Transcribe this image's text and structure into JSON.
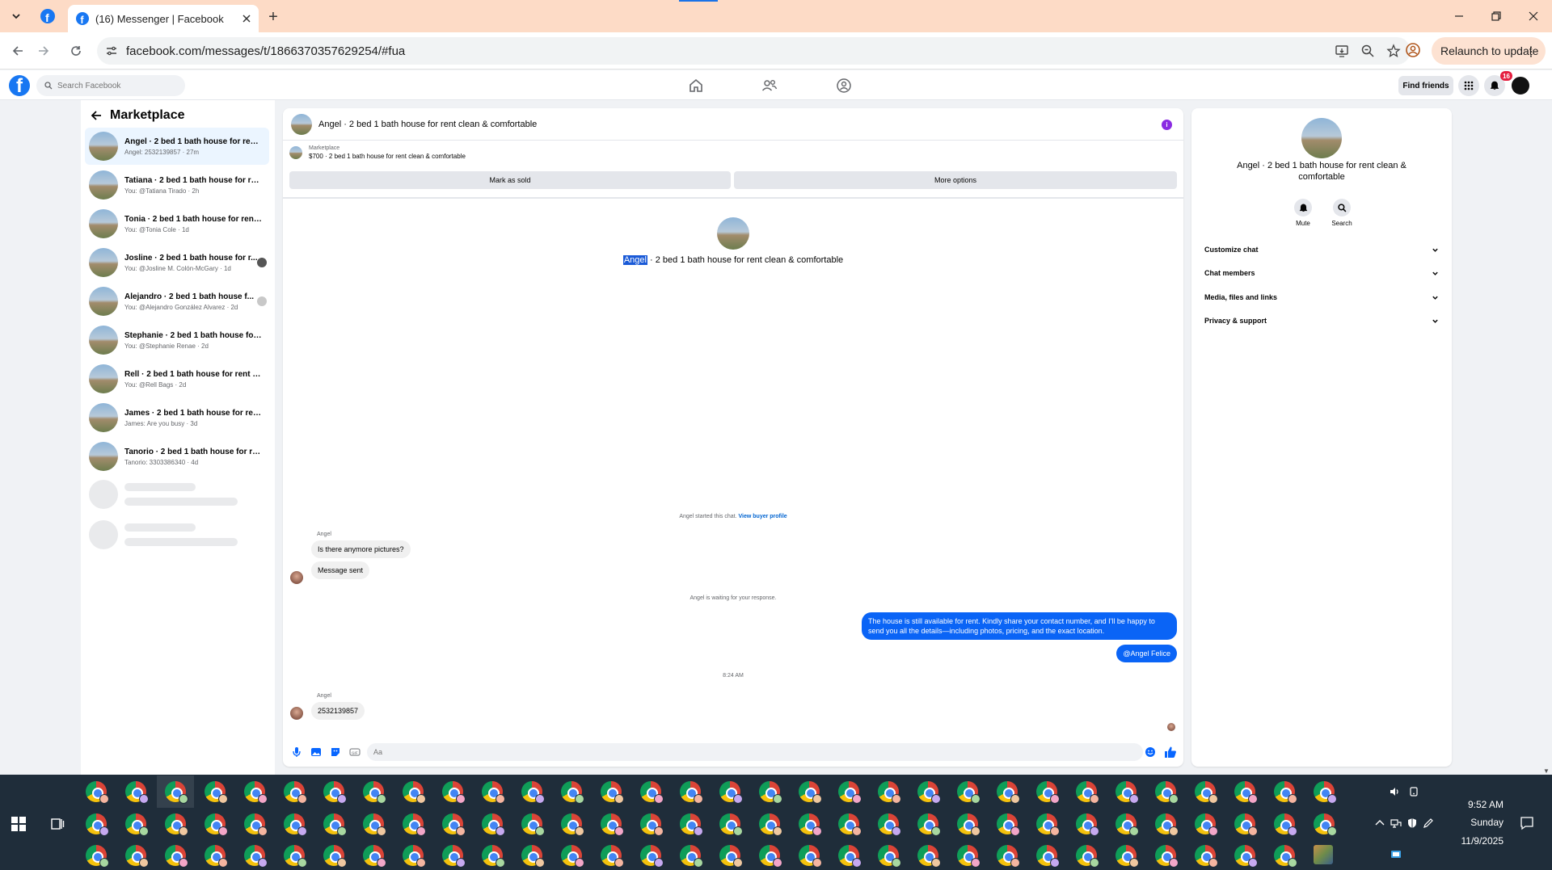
{
  "browser": {
    "tab_title": "(16) Messenger | Facebook",
    "url": "facebook.com/messages/t/1866370357629254/#fua",
    "relaunch_label": "Relaunch to update"
  },
  "fb": {
    "search_placeholder": "Search Facebook",
    "find_friends_label": "Find friends",
    "notification_count": "16",
    "brand_color": "#1877f2"
  },
  "sidebar": {
    "title": "Marketplace",
    "conversations": [
      {
        "name": "Angel · 2 bed 1 bath house for rent...",
        "sub": "Angel: 2532139857 · 27m"
      },
      {
        "name": "Tatiana · 2 bed 1 bath house for re...",
        "sub": "You: @Tatiana Tirado · 2h"
      },
      {
        "name": "Tonia · 2 bed 1 bath house for rent...",
        "sub": "You: @Tonia Cole · 1d"
      },
      {
        "name": "Josline · 2 bed 1 bath house for r...",
        "sub": "You: @Josline M. Colón-McGary · 1d"
      },
      {
        "name": "Alejandro · 2 bed 1 bath house f...",
        "sub": "You: @Alejandro González Alvarez · 2d"
      },
      {
        "name": "Stephanie · 2 bed 1 bath house for ...",
        "sub": "You: @Stephanie Renae · 2d"
      },
      {
        "name": "Rell · 2 bed 1 bath house for rent cl...",
        "sub": "You: @Rell Bags · 2d"
      },
      {
        "name": "James · 2 bed 1 bath house for ren...",
        "sub": "James: Are you busy · 3d"
      },
      {
        "name": "Tanorio · 2 bed 1 bath house for re...",
        "sub": "Tanorio: 3303386340 · 4d"
      }
    ]
  },
  "chat": {
    "header_title": "Angel · 2 bed 1 bath house for rent clean & comfortable",
    "marketplace_label": "Marketplace",
    "listing": "$700 · 2 bed 1 bath house for rent clean & comfortable",
    "mark_sold_label": "Mark as sold",
    "more_options_label": "More options",
    "center_name": "Angel",
    "center_rest": " · 2 bed 1 bath house for rent clean & comfortable",
    "started_text": "Angel started this chat.",
    "view_buyer_label": "View buyer profile",
    "sender_name": "Angel",
    "msg1": "Is there anymore pictures?",
    "msg2": "Message sent",
    "waiting_text": "Angel is waiting for your response.",
    "out_msg": "The house is still available for rent. Kindly share your contact number, and I'll be happy to send you all the details—including photos, pricing, and the exact location.",
    "out_mention": "@Angel Felice",
    "time_label": "8:24 AM",
    "sender_name2": "Angel",
    "msg3": "2532139857",
    "composer_placeholder": "Aa",
    "accent_color": "#0a64f6"
  },
  "details": {
    "title": "Angel · 2 bed 1 bath house for rent clean & comfortable",
    "mute_label": "Mute",
    "search_label": "Search",
    "rows": [
      "Customize chat",
      "Chat members",
      "Media, files and links",
      "Privacy & support"
    ]
  },
  "taskbar": {
    "time": "9:52 AM",
    "day": "Sunday",
    "date": "11/9/2025"
  }
}
